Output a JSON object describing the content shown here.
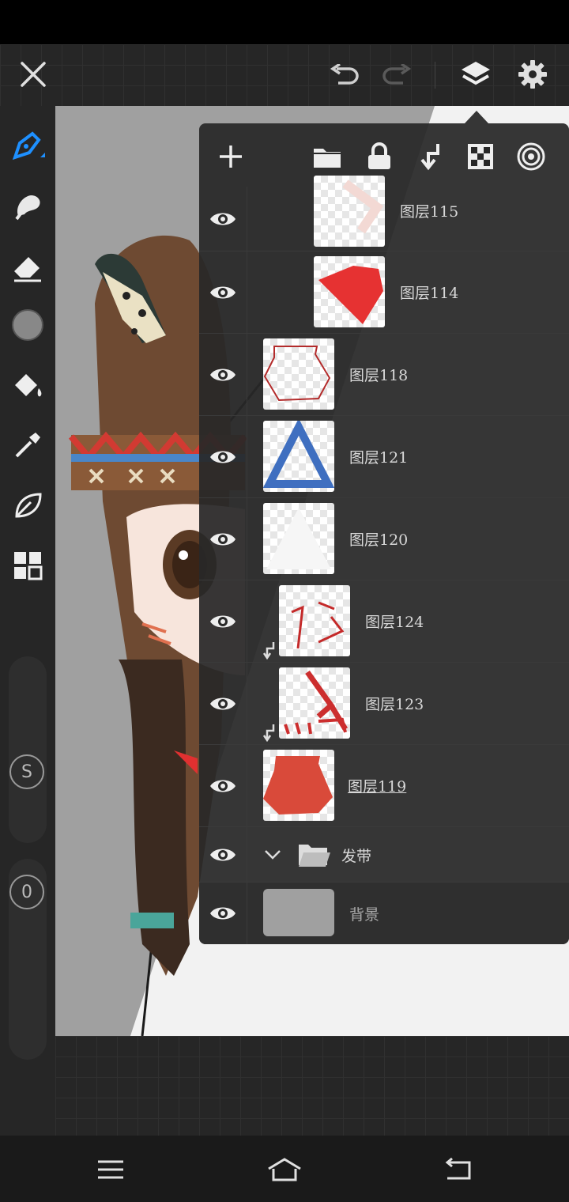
{
  "app": {
    "accent": "#1e90ff"
  },
  "top_bar": {
    "close_icon": "close-icon",
    "undo_icon": "undo-icon",
    "redo_icon": "redo-icon",
    "layers_icon": "layers-icon",
    "settings_icon": "gear-icon"
  },
  "tools": [
    "pen-icon",
    "smudge-icon",
    "eraser-icon",
    "color-swatch",
    "fill-bucket-icon",
    "eyedropper-icon",
    "leaf-icon",
    "grid-icon"
  ],
  "size_slider": {
    "label": "S"
  },
  "opacity_slider": {
    "label": "0"
  },
  "layers_toolbar": [
    "add-layer-icon",
    "folder-icon",
    "lock-icon",
    "clip-icon",
    "transparency-icon",
    "blend-icon"
  ],
  "layers": [
    {
      "name": "图层115",
      "visible": true
    },
    {
      "name": "图层114",
      "visible": true
    },
    {
      "name": "图层118",
      "visible": true
    },
    {
      "name": "图层121",
      "visible": true
    },
    {
      "name": "图层120",
      "visible": true
    },
    {
      "name": "图层124",
      "visible": true,
      "clipped": true
    },
    {
      "name": "图层123",
      "visible": true,
      "clipped": true
    },
    {
      "name": "图层119",
      "visible": true,
      "selected": true
    },
    {
      "name": "发带",
      "visible": true,
      "folder": true
    },
    {
      "name": "背景",
      "visible": true
    }
  ],
  "nav": [
    "menu-icon",
    "home-icon",
    "back-icon"
  ]
}
